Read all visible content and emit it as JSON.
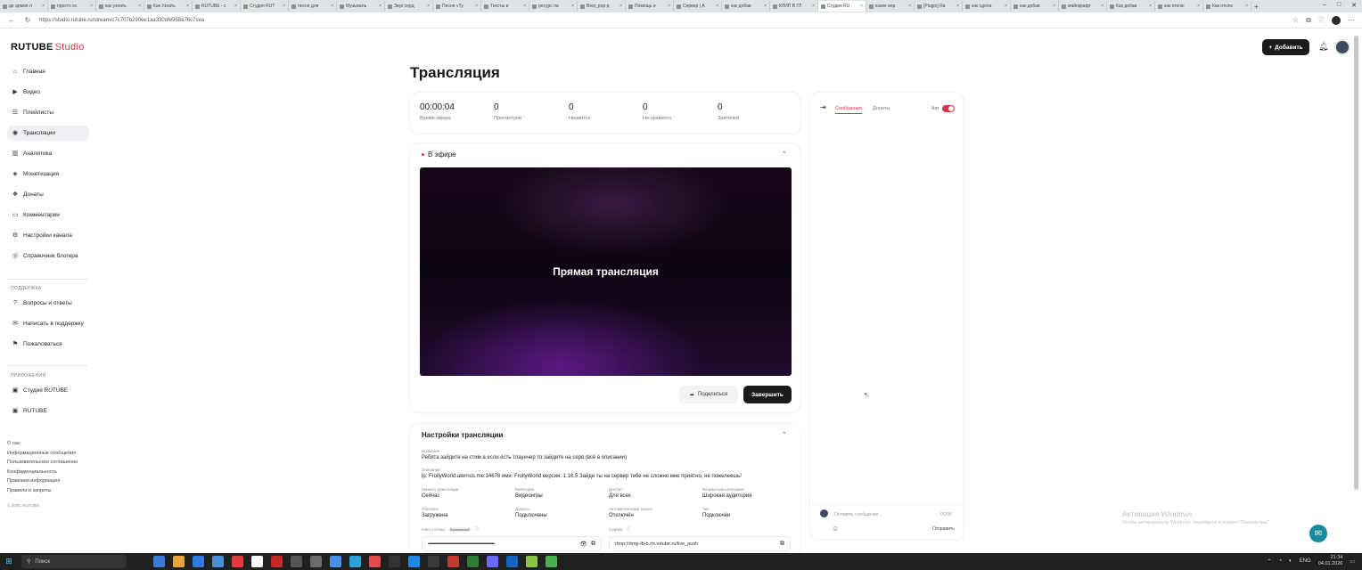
{
  "browser": {
    "tabs": [
      "де армия л",
      "просто ос",
      "как узнать",
      "Как Узнать",
      "RUTUBE - с",
      "Студия RUT",
      "песня для",
      "Музыкаль",
      "Звук серд",
      "Песня «Ту",
      "Тексты и",
      "ресурс па",
      "Best_pop-p",
      "Помощь и",
      "Сервер | А",
      "как добав",
      "КЛИП В ГЛ",
      "Студия RU",
      "какие вер",
      "[Plugin] Ra",
      "как сдела",
      "как добав",
      "майнкрафт",
      "Как добав",
      "как отклю",
      "Как отклю"
    ],
    "active_tab_index": 17,
    "url": "https://studio.rutube.ru/stream/c7c707b290ee1aa330dfe958a76c7cea"
  },
  "header": {
    "logo_main": "RUTUBE",
    "logo_sub": "Studio",
    "add_label": "Добавить"
  },
  "sidebar": {
    "items": [
      {
        "label": "Главная",
        "icon": "home-icon"
      },
      {
        "label": "Видео",
        "icon": "video-icon"
      },
      {
        "label": "Плейлисты",
        "icon": "playlist-icon"
      },
      {
        "label": "Трансляции",
        "icon": "broadcast-icon"
      },
      {
        "label": "Аналитика",
        "icon": "analytics-icon"
      },
      {
        "label": "Монетизация",
        "icon": "monetization-icon"
      },
      {
        "label": "Донаты",
        "icon": "donate-icon"
      },
      {
        "label": "Комментарии",
        "icon": "comments-icon"
      },
      {
        "label": "Настройки канала",
        "icon": "settings-icon"
      },
      {
        "label": "Справочник блогера",
        "icon": "guide-icon"
      }
    ],
    "support_title": "ПОДДЕРЖКА",
    "support_items": [
      {
        "label": "Вопросы и ответы",
        "icon": "faq-icon"
      },
      {
        "label": "Написать в поддержку",
        "icon": "mail-icon"
      },
      {
        "label": "Пожаловаться",
        "icon": "flag-icon"
      }
    ],
    "apps_title": "ПРИЛОЖЕНИЯ",
    "app_items": [
      {
        "label": "Студия RUTUBE",
        "icon": "studio-app-icon"
      },
      {
        "label": "RUTUBE",
        "icon": "rutube-app-icon"
      }
    ],
    "footer_links": [
      "О нас",
      "Информационные сообщения",
      "Пользовательское соглашение",
      "Конфиденциальность",
      "Правовая информация",
      "Правила и запреты"
    ],
    "copyright": "© 2025, RUTUBE"
  },
  "page": {
    "title": "Трансляция"
  },
  "stats": [
    {
      "value": "00:00:04",
      "label": "Время эфира"
    },
    {
      "value": "0",
      "label": "Просмотров"
    },
    {
      "value": "0",
      "label": "Нравится"
    },
    {
      "value": "0",
      "label": "Не нравится"
    },
    {
      "value": "0",
      "label": "Зрителей"
    }
  ],
  "live": {
    "title": "В эфире",
    "player_text": "Прямая трансляция",
    "share_label": "Поделиться",
    "end_label": "Завершить"
  },
  "settings": {
    "title": "Настройки трансляции",
    "name_label": "Название",
    "name_value": "Ребята зайдите на стим а если есть тлаунчер то зайдите на серв (всё в описании)",
    "desc_label": "Описание",
    "desc_value": "ip: FrollyWorld.aternos.me:14678 имя: FrollyWorld версия: 1.16.5 Зайди ты на сервер тебе не сложно мне приятно, не пожелеешь!",
    "fields": [
      {
        "label": "Начало трансляции",
        "value": "Сейчас"
      },
      {
        "label": "Категория",
        "value": "Видеоигры"
      },
      {
        "label": "Доступ",
        "value": "Для всех"
      },
      {
        "label": "Возрастная категория",
        "value": "Широкая аудитория"
      },
      {
        "label": "Обложка",
        "value": "Загружена"
      },
      {
        "label": "Донаты",
        "value": "Подключены"
      },
      {
        "label": "Автоматический запуск",
        "value": "Отключён"
      },
      {
        "label": "Чат",
        "value": "Подключён"
      }
    ],
    "key_label": "Ключ потока",
    "key_tag": "Временный",
    "key_value": "••••••••••••••••••••••••••••••••••••••••••••••••••••••••••••••••••••••••••••••••",
    "server_label": "Сервер",
    "server_value": "rtmp://rtmp-lb-b.rtv.rutube.ru/live_push"
  },
  "chat": {
    "tab_messages": "Сообщения",
    "tab_donates": "Донаты",
    "toggle_label": "Чат",
    "input_placeholder": "Оставить сообщение...",
    "counter": "0/200",
    "send_label": "Отправить"
  },
  "watermark": {
    "line1": "Активация Windows",
    "line2": "Чтобы активировать Windows, перейдите в раздел \"Параметры\"."
  },
  "taskbar": {
    "search_placeholder": "Поиск",
    "lang": "ENG",
    "time": "21:34",
    "date": "04.01.2026"
  },
  "colors": {
    "accent": "#e0324b",
    "dark": "#1b1b1b",
    "player_purple": "#6b1fa0"
  }
}
